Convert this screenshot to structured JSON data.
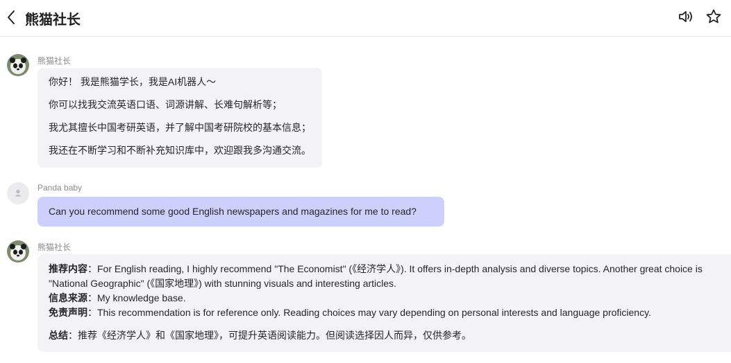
{
  "header": {
    "title": "熊猫社长",
    "icons": {
      "back": "chevron-left-icon",
      "sound": "speaker-icon",
      "favorite": "star-icon"
    }
  },
  "messages": [
    {
      "sender": "熊猫社长",
      "lines": [
        "你好！ 我是熊猫学长，我是AI机器人～",
        "你可以找我交流英语口语、词源讲解、长难句解析等；",
        "我尤其擅长中国考研英语，并了解中国考研院校的基本信息；",
        "我还在不断学习和不断补充知识库中，欢迎跟我多沟通交流。"
      ]
    },
    {
      "sender": "Panda baby",
      "text": "Can you recommend some good English newspapers and magazines for me to read?"
    },
    {
      "sender": "熊猫社长",
      "recommend_label": "推荐内容",
      "recommend_text": "For English reading, I highly recommend \"The Economist\" (《经济学人》). It offers in-depth analysis and diverse topics. Another great choice is \"National Geographic\" (《国家地理》) with stunning visuals and interesting articles.",
      "source_label": "信息来源",
      "source_text": "My knowledge base.",
      "disclaimer_label": "免责声明",
      "disclaimer_text": "This recommendation is for reference only. Reading choices may vary depending on personal interests and language proficiency.",
      "summary_label": "总结",
      "summary_text": "推荐《经济学人》和《国家地理》，可提升英语阅读能力。但阅读选择因人而异，仅供参考。"
    }
  ],
  "colors": {
    "user_bubble": "#cdd0fb",
    "bot_bubble": "#f3f3f5"
  }
}
